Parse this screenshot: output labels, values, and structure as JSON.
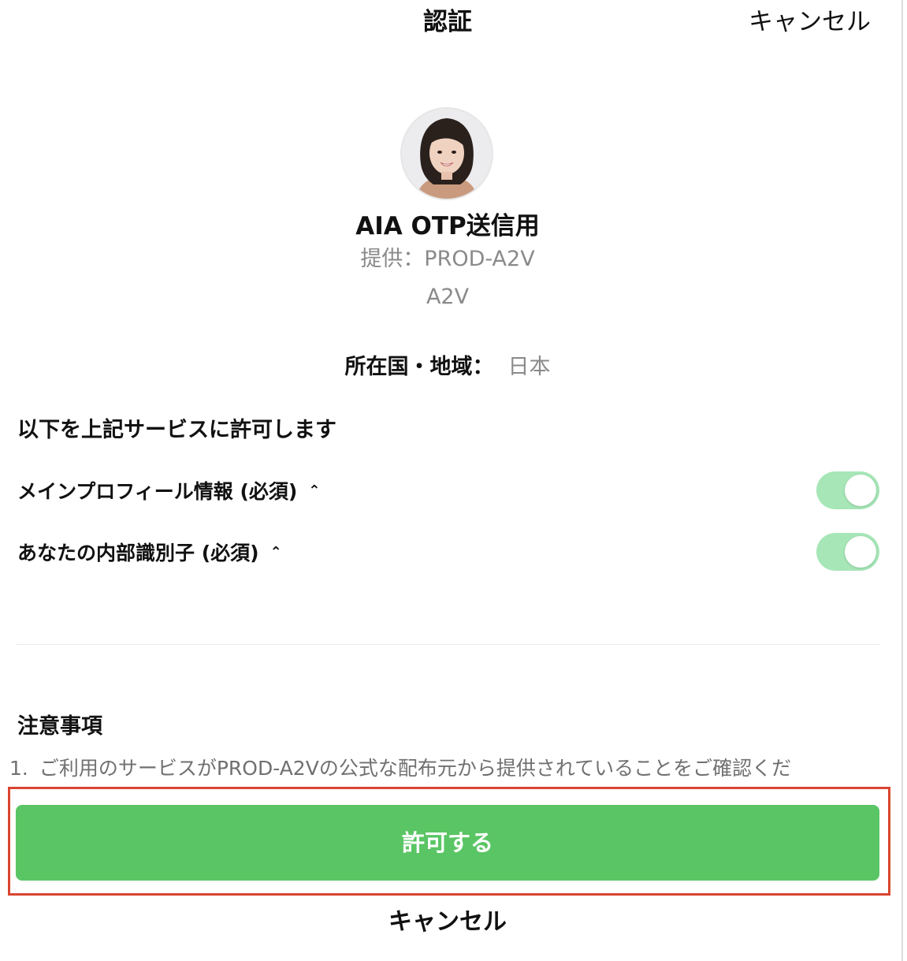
{
  "header": {
    "title": "認証",
    "cancel_label": "キャンセル"
  },
  "app": {
    "avatar_icon": "profile-photo",
    "name": "AIA OTP送信用",
    "provider": "提供：PROD-A2V",
    "provider_sub": "A2V"
  },
  "region": {
    "label": "所在国・地域：",
    "value": "日本"
  },
  "permissions": {
    "title": "以下を上記サービスに許可します",
    "items": [
      {
        "label": "メインプロフィール情報 (必須)",
        "chevron": "⌃",
        "enabled": true
      },
      {
        "label": "あなたの内部識別子 (必須)",
        "chevron": "⌃",
        "enabled": true
      }
    ],
    "toggle_color": "#a6e6b7"
  },
  "notes": {
    "title": "注意事項",
    "items": [
      {
        "number": "1.",
        "text": "ご利用のサービスがPROD-A2Vの公式な配布元から提供されていることをご確認くだ"
      }
    ]
  },
  "actions": {
    "allow_label": "許可する",
    "cancel_label": "キャンセル",
    "allow_color": "#5ac564",
    "highlight_color": "#d9452f"
  }
}
